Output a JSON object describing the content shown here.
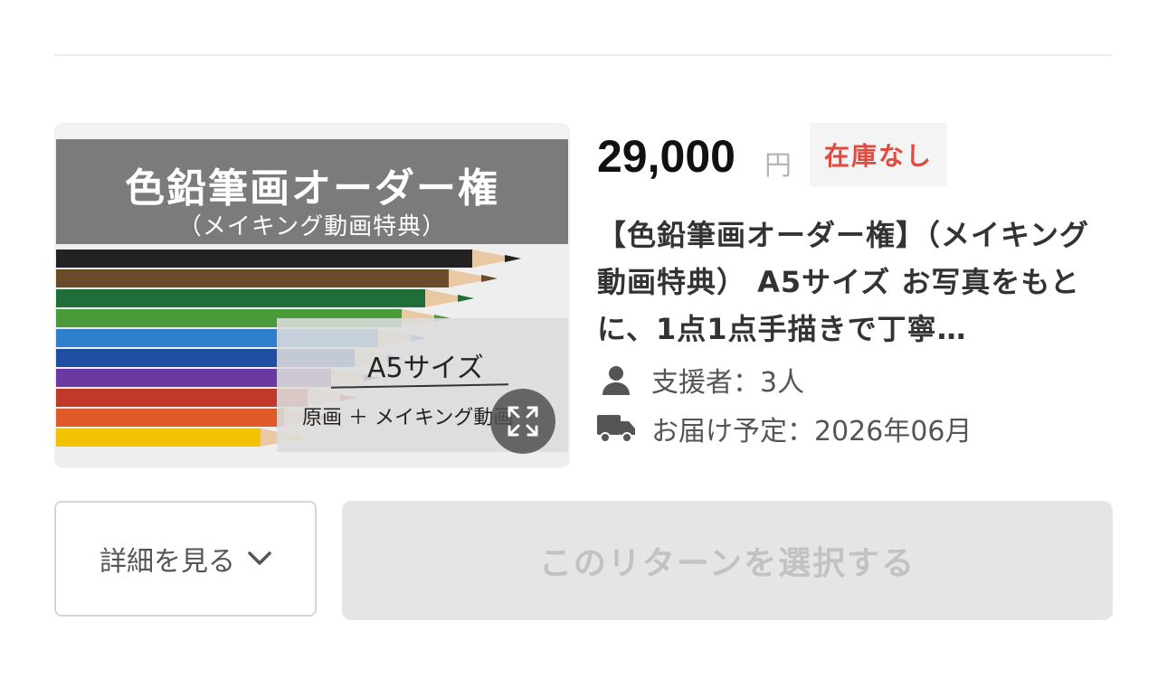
{
  "thumbnail": {
    "banner_title": "色鉛筆画オーダー権",
    "banner_subtitle": "（メイキング動画特典）",
    "overlay_size": "A5サイズ",
    "overlay_caption": "原画 ＋ メイキング動画",
    "pencil_colors": [
      "#222222",
      "#6b4a2a",
      "#1f6e3a",
      "#4a9a3a",
      "#2f7fcf",
      "#1e4fa0",
      "#6a3aa0",
      "#c0392b",
      "#e05a28",
      "#f2c200"
    ]
  },
  "reward": {
    "price": "29,000",
    "currency": "円",
    "stock_badge": "在庫なし",
    "title": "【色鉛筆画オーダー権】（メイキング動画特典） A5サイズ お写真をもとに、1点1点手描きで丁寧…",
    "supporters_text": "支援者：3人",
    "delivery_text": "お届け予定：2026年06月"
  },
  "buttons": {
    "details_label": "詳細を見る",
    "select_label": "このリターンを選択する"
  },
  "icons": {
    "supporters": "person-icon",
    "delivery": "truck-icon",
    "expand": "expand-icon",
    "details": "chevron-down-icon"
  },
  "colors": {
    "stock_badge_text": "#e04a40",
    "disabled_button_bg": "#e5e5e5",
    "disabled_button_text": "#c2c2c2"
  }
}
